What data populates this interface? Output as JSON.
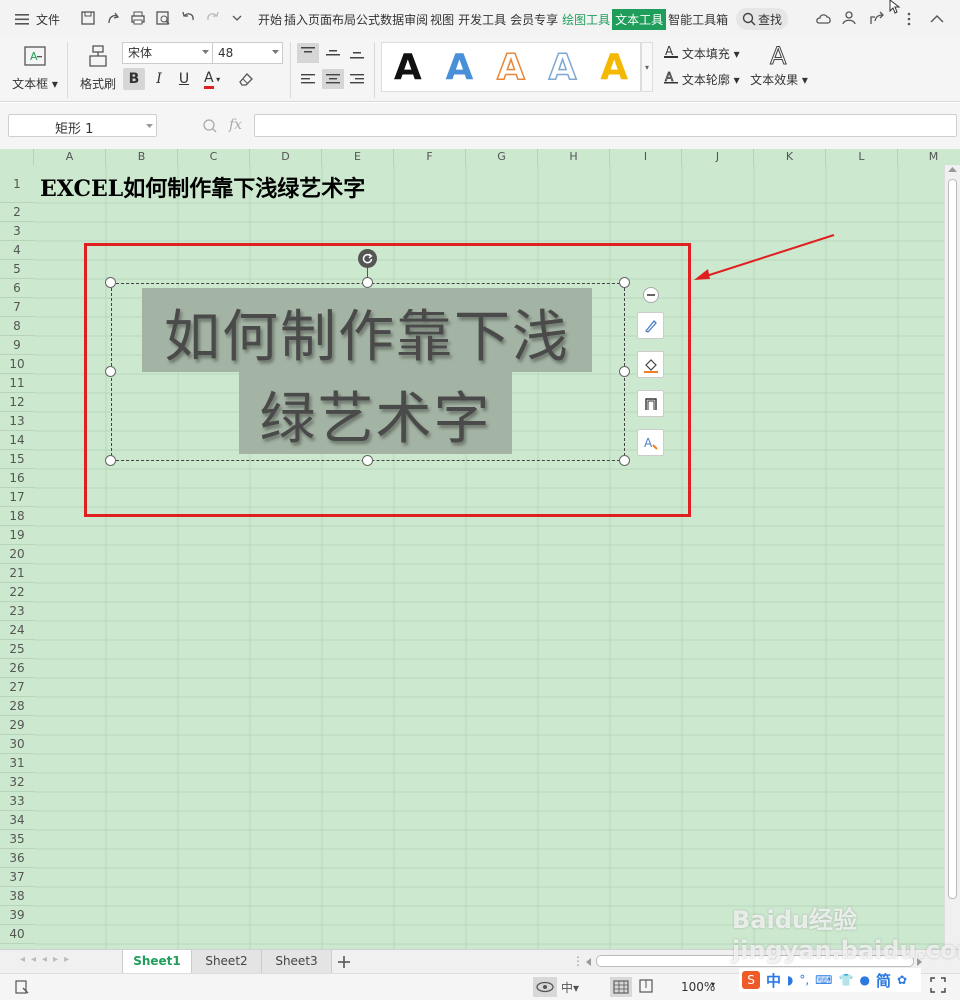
{
  "menubar": {
    "file_label": "文件",
    "tabs": [
      "开始",
      "插入",
      "页面布局",
      "公式",
      "数据",
      "审阅",
      "视图",
      "开发工具",
      "会员专享",
      "绘图工具",
      "文本工具",
      "智能工具箱"
    ],
    "search_label": "查找"
  },
  "ribbon": {
    "textbox_label": "文本框",
    "format_painter_label": "格式刷",
    "font_name": "宋体",
    "font_size": "48",
    "bold_label": "B",
    "italic_label": "I",
    "underline_label": "U",
    "font_color_label": "A",
    "text_fill_label": "文本填充",
    "text_outline_label": "文本轮廓",
    "text_effect_label": "文本效果",
    "styles": [
      {
        "glyph": "A",
        "color": "#111111"
      },
      {
        "glyph": "A",
        "color": "#4a90d9"
      },
      {
        "glyph": "A",
        "color": "#e8873a"
      },
      {
        "glyph": "A",
        "color": "#7fa7d4"
      },
      {
        "glyph": "A",
        "color": "#f5b800"
      }
    ]
  },
  "formula_bar": {
    "name_box": "矩形 1",
    "fx_label": "fx",
    "content": ""
  },
  "sheet": {
    "columns": [
      "A",
      "B",
      "C",
      "D",
      "E",
      "F",
      "G",
      "H",
      "I",
      "J",
      "K",
      "L",
      "M"
    ],
    "rows": [
      "1",
      "2",
      "3",
      "4",
      "5",
      "6",
      "7",
      "8",
      "9",
      "10",
      "11",
      "12",
      "13",
      "14",
      "15",
      "16",
      "17",
      "18",
      "19",
      "20",
      "21",
      "22",
      "23",
      "24",
      "25",
      "26",
      "27",
      "28",
      "29",
      "30",
      "31",
      "32",
      "33",
      "34",
      "35",
      "36",
      "37",
      "38",
      "39",
      "40"
    ],
    "a1": "EXCEL如何制作靠下浅绿艺术字",
    "art_line1": "如何制作靠下浅",
    "art_line2": "绿艺术字"
  },
  "sheet_tabs": [
    "Sheet1",
    "Sheet2",
    "Sheet3"
  ],
  "status": {
    "zoom": "100%"
  },
  "watermark": "Baidu经验 jingyan.baidu.com",
  "ime": {
    "lang": "中",
    "simplified": "简"
  },
  "colors": {
    "active_tab": "#1e9e5a",
    "sheet_bg": "#cce8cf",
    "highlight": "#e02020"
  }
}
